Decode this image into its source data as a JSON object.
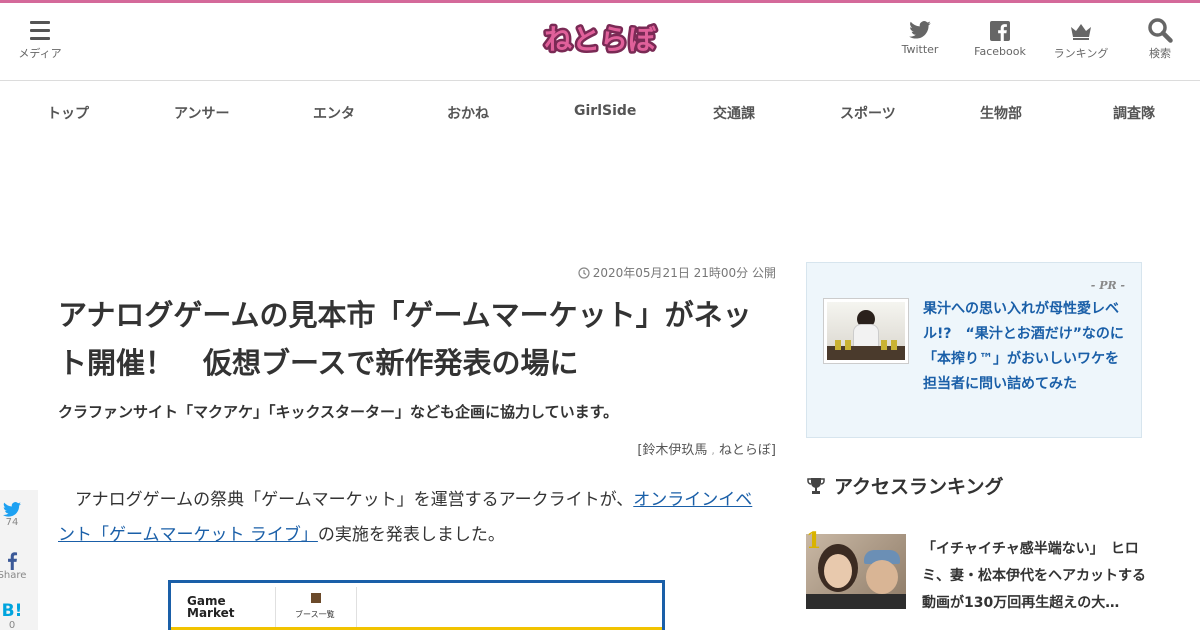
{
  "header": {
    "menu_label": "メディア",
    "logo_text": "ねとらぼ",
    "icons": [
      {
        "name": "twitter-icon",
        "label": "Twitter"
      },
      {
        "name": "facebook-icon",
        "label": "Facebook"
      },
      {
        "name": "ranking-icon",
        "label": "ランキング"
      },
      {
        "name": "search-icon",
        "label": "検索"
      }
    ]
  },
  "nav": {
    "items": [
      "トップ",
      "アンサー",
      "エンタ",
      "おかね",
      "GirlSide",
      "交通課",
      "スポーツ",
      "生物部",
      "調査隊"
    ]
  },
  "article": {
    "date": "2020年05月21日 21時00分 公開",
    "title": "アナログゲームの見本市「ゲームマーケット」がネット開催！　仮想ブースで新作発表の場に",
    "subtitle": "クラファンサイト「マクアケ」「キックスターター」なども企画に協力しています。",
    "author": "[鈴木伊玖馬",
    "site": "ねとらぼ]",
    "body_before": "　アナログゲームの祭典「ゲームマーケット」を運営するアークライトが、",
    "body_link": "オンラインイベント「ゲームマーケット ライブ」",
    "body_after": "の実施を発表しました。",
    "image": {
      "logo_line1": "Game",
      "logo_line2": "Market",
      "booth_label": "ブース一覧"
    }
  },
  "share": {
    "twitter_count": "74",
    "facebook_label": "Share",
    "hatena_label": "B!",
    "hatena_count": "0"
  },
  "sidebar": {
    "pr_label": "- PR -",
    "pr_text": "果汁への思い入れが母性愛レベル!?　“果汁とお酒だけ”なのに「本搾り™」がおいしいワケを担当者に問い詰めてみた",
    "ranking_heading": "アクセスランキング",
    "ranking": [
      {
        "rank": "1",
        "title": "「イチャイチャ感半端ない」　ヒロミ、妻・松本伊代をヘアカットする動画が130万回再生超えの大…"
      }
    ]
  },
  "colors": {
    "accent": "#d4699a",
    "link": "#1a5fa8",
    "rank_gold": "#d9b300"
  }
}
